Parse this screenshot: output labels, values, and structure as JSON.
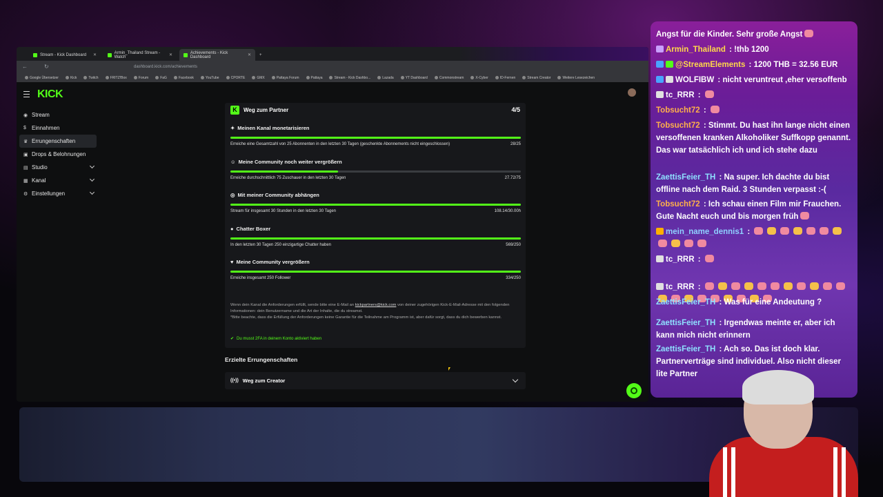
{
  "browser": {
    "tabs": [
      {
        "title": "Stream - Kick Dashboard"
      },
      {
        "title": "Armin_Thailand Stream - Watch"
      },
      {
        "title": "Achievements - Kick Dashboard",
        "active": true
      }
    ],
    "url": "dashboard.kick.com/achievements",
    "bookmarks": [
      "Google Übersetzer",
      "Kick",
      "Twitch",
      "FRITZ!Box",
      "Forum",
      "FaG",
      "Facebook",
      "YouTube",
      "CPORTE",
      "GMX",
      "Pattaya Forum",
      "Pattaya",
      "Stream - Kick Dashbo...",
      "Lazada",
      "YT Dashboard",
      "Commonstream",
      "X-Cyber",
      "ID-Fernen",
      "Stream Creator",
      "Weitere Lesezeichen"
    ]
  },
  "kick": {
    "logo": "KICK",
    "sidebar": [
      {
        "icon": "stream-icon",
        "label": "Stream"
      },
      {
        "icon": "dollar-icon",
        "label": "Einnahmen"
      },
      {
        "icon": "trophy-icon",
        "label": "Errungenschaften",
        "active": true
      },
      {
        "icon": "gift-icon",
        "label": "Drops & Belohnungen"
      },
      {
        "icon": "studio-icon",
        "label": "Studio",
        "expandable": true
      },
      {
        "icon": "channel-icon",
        "label": "Kanal",
        "expandable": true
      },
      {
        "icon": "gear-icon",
        "label": "Einstellungen",
        "expandable": true
      }
    ],
    "card": {
      "badge": "K",
      "title": "Weg zum Partner",
      "progress": "4/5",
      "requirements": [
        {
          "icon": "sparkle-icon",
          "title": "Meinen Kanal monetarisieren",
          "description": "Erreiche eine Gesamtzahl von 25 Abonnenten in den letzten 30 Tagen (geschenkte Abonnements nicht eingeschlossen)",
          "value": "28/25",
          "fraction": 1.0
        },
        {
          "icon": "users-icon",
          "title": "Meine Community noch weiter vergrößern",
          "description": "Erreiche durchschnittlich 75 Zuschauer in den letzten 30 Tagen",
          "value": "27.72/75",
          "fraction": 0.37
        },
        {
          "icon": "broadcast-icon",
          "title": "Mit meiner Community abhängen",
          "description": "Stream für insgesamt 30 Stunden in den letzten 30 Tagen",
          "value": "108.14/30.00h",
          "fraction": 1.0
        },
        {
          "icon": "chat-icon",
          "title": "Chatter Boxer",
          "description": "In den letzten 30 Tagen 250 einzigartige Chatter haben",
          "value": "569/250",
          "fraction": 1.0
        },
        {
          "icon": "heart-icon",
          "title": "Meine Community vergrößern",
          "description": "Erreiche insgesamt 250 Follower",
          "value": "334/250",
          "fraction": 1.0
        }
      ],
      "note_prefix": "Wenn dein Kanal die Anforderungen erfüllt, sende bitte eine E-Mail an",
      "note_email": "kickpartners@kick.com",
      "note_suffix": "von deiner zugehörigen Kick-E-Mail-Adresse mit den folgenden Informationen: dein Benutzername und die Art der Inhalte, die du streamst.",
      "note_disclaimer": "*Bitte beachte, dass die Erfüllung der Anforderungen keine Garantie für die Teilnahme am Programm ist, aber dafür sorgt, dass du dich bewerben kannst.",
      "tfa": "Du musst 2FA in deinem Konto aktiviert haben"
    },
    "achieved_title": "Erzielte Errungenschaften",
    "creator_item": "Weg zum Creator"
  },
  "chat": [
    {
      "text": "Angst für die Kinder. Sehr große Angst",
      "emotes": 1
    },
    {
      "name": "Armin_Thailand",
      "name_color": "#ffd84a",
      "badges": [
        "#c9a0ff"
      ],
      "text": "!thb 1200"
    },
    {
      "name": "@StreamElements",
      "name_color": "#ffd84a",
      "badges": [
        "#4aa3ff",
        "#53fc18"
      ],
      "text": "1200 THB = 32.56 EUR"
    },
    {
      "name": "WOLFIBW",
      "name_color": "#ffffff",
      "badges": [
        "#4aa3ff",
        "#e0e0e0"
      ],
      "text": "nicht veruntreut ,eher versoffenb"
    },
    {
      "name": "tc_RRR",
      "name_color": "#ffffff",
      "badges": [
        "#e0e0e0"
      ],
      "text": "",
      "emotes": 1
    },
    {
      "name": "Tobsucht72",
      "name_color": "#ffb04a",
      "text": "",
      "emotes": 1
    },
    {
      "name": "Tobsucht72",
      "name_color": "#ffb04a",
      "text": "Stimmt. Du hast ihn lange nicht einen versoffenen kranken Alkoholiker Suffkopp genannt. Das war tatsächlich ich und ich stehe dazu"
    },
    {
      "name": "ZaettisFeier_TH",
      "name_color": "#8fe0ff",
      "text": "Na super. Ich dachte du bist offline nach dem Raid. 3 Stunden verpasst :-("
    },
    {
      "name": "Tobsucht72",
      "name_color": "#ffb04a",
      "text": "Ich schau einen Film mir Frauchen. Gute Nacht euch und bis morgen früh",
      "emotes": 1
    },
    {
      "name": "mein_name_dennis1",
      "name_color": "#8fd0ff",
      "badges": [
        "#ffb000"
      ],
      "text": "",
      "emotes": 11
    },
    {
      "name": "tc_RRR",
      "name_color": "#ffffff",
      "badges": [
        "#e0e0e0"
      ],
      "text": "",
      "emotes": 1
    },
    {
      "name": "tc_RRR",
      "name_color": "#ffffff",
      "badges": [
        "#e0e0e0"
      ],
      "text": "",
      "emotes": 20
    },
    {
      "name": "ZaettisFeier_TH",
      "name_color": "#8fe0ff",
      "text": "Was für eine Andeutung ?"
    },
    {
      "name": "ZaettisFeier_TH",
      "name_color": "#8fe0ff",
      "text": "Irgendwas meinte er, aber ich kann mich nicht erinnern"
    },
    {
      "name": "ZaettisFeier_TH",
      "name_color": "#8fe0ff",
      "text": "Ach so. Das ist doch klar. Partnerverträge sind individuel. Also nicht dieser lite Partner"
    }
  ],
  "colors": {
    "kick_green": "#53fc18",
    "card_bg": "#17181b",
    "page_bg": "#0e0f10"
  }
}
